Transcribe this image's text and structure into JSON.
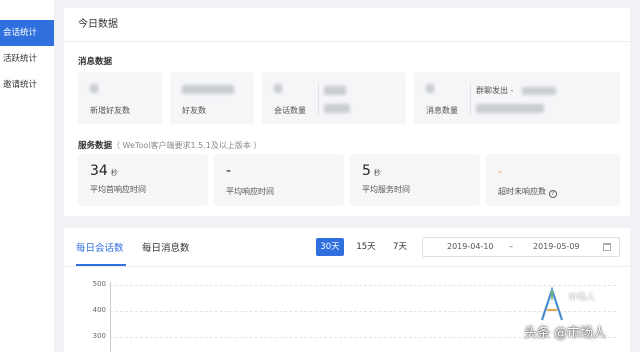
{
  "sidebar": {
    "items": [
      {
        "label": "会话统计",
        "active": true
      },
      {
        "label": "活跃统计",
        "active": false
      },
      {
        "label": "邀请统计",
        "active": false
      }
    ]
  },
  "today": {
    "title": "今日数据",
    "messages_label": "消息数据",
    "message_boxes": [
      {
        "caption": "新增好友数"
      },
      {
        "caption": "好友数"
      },
      {
        "caption": "会话数量"
      },
      {
        "caption": "消息数量",
        "sub_caption": "群聊发出 -"
      }
    ],
    "service_label": "服务数据",
    "service_hint": "（ WeTool客户端要求1.5.1及以上版本 ）",
    "service_boxes": [
      {
        "value": "34",
        "unit": "秒",
        "caption": "平均首响应时间"
      },
      {
        "value": "-",
        "unit": "",
        "caption": "平均响应时间"
      },
      {
        "value": "5",
        "unit": "秒",
        "caption": "平均服务时间"
      },
      {
        "value": "-",
        "unit": "",
        "caption": "超时未响应数"
      }
    ]
  },
  "chart_panel": {
    "tabs": [
      {
        "label": "每日会话数",
        "active": true
      },
      {
        "label": "每日消息数",
        "active": false
      }
    ],
    "ranges": [
      {
        "label": "30天",
        "active": true
      },
      {
        "label": "15天",
        "active": false
      },
      {
        "label": "7天",
        "active": false
      }
    ],
    "date_start": "2019-04-10",
    "date_sep": "–",
    "date_end": "2019-05-09",
    "y_ticks": [
      "500",
      "400",
      "300"
    ]
  },
  "chart_data": {
    "type": "line",
    "title": "",
    "xlabel": "",
    "ylabel": "",
    "y_ticks": [
      500,
      400,
      300
    ],
    "series": []
  },
  "watermark": {
    "small": "市场人",
    "main": "头条 @市场人"
  },
  "colors": {
    "accent": "#2f6fde",
    "warning": "#f5852a",
    "background": "#f0f2f5"
  }
}
